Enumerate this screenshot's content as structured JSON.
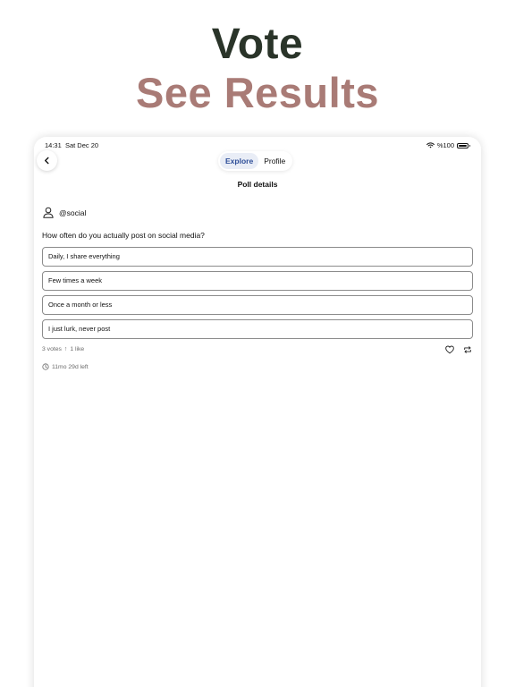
{
  "promo": {
    "headline_1": "Vote",
    "headline_2": "See Results",
    "headline_1_color": "#2a3429",
    "headline_2_color": "#a97b76"
  },
  "status_bar": {
    "time": "14:31",
    "date": "Sat Dec 20",
    "battery": "%100"
  },
  "nav": {
    "back_icon": "chevron-left-icon",
    "tabs": [
      {
        "label": "Explore",
        "active": true
      },
      {
        "label": "Profile",
        "active": false
      }
    ],
    "accent_color": "#2f4f99"
  },
  "screen_title": "Poll details",
  "poll": {
    "author_icon": "person-icon",
    "author": "@social",
    "question": "How often do you actually post on social media?",
    "options": [
      "Daily, I share everything",
      "Few times a week",
      "Once a month or less",
      "I just lurk, never post"
    ],
    "votes": "3 votes",
    "separator": "↑",
    "likes": "1 like",
    "like_icon": "heart-icon",
    "repost_icon": "repost-icon",
    "time_icon": "timer-icon",
    "time_left": "11mo 29d left"
  }
}
